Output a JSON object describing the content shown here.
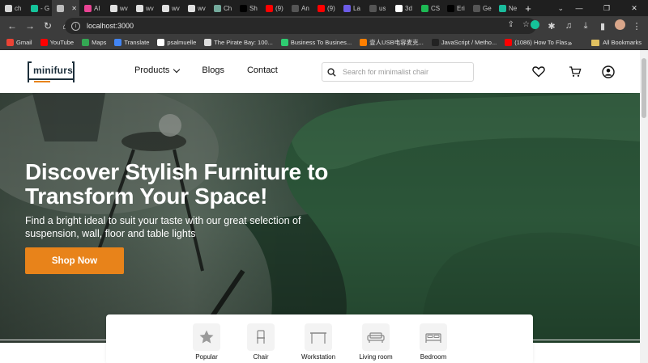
{
  "browser": {
    "tabs": [
      {
        "title": "ch",
        "color": "#d6d6d6"
      },
      {
        "title": "- G",
        "color": "#15c39a"
      },
      {
        "title": "",
        "color": "#bdbdbd",
        "active": true
      },
      {
        "title": "AI",
        "color": "#e84393"
      },
      {
        "title": "wv",
        "color": "#e0e0e0"
      },
      {
        "title": "wv",
        "color": "#e0e0e0"
      },
      {
        "title": "wv",
        "color": "#e0e0e0"
      },
      {
        "title": "wv",
        "color": "#e0e0e0"
      },
      {
        "title": "Ch",
        "color": "#74aa9c"
      },
      {
        "title": "Sh",
        "color": "#000000"
      },
      {
        "title": "(9)",
        "color": "#ff0000"
      },
      {
        "title": "An",
        "color": "#555555"
      },
      {
        "title": "(9)",
        "color": "#ff0000"
      },
      {
        "title": "La",
        "color": "#6c5ce7"
      },
      {
        "title": "us",
        "color": "#555555"
      },
      {
        "title": "3d",
        "color": "#ffffff"
      },
      {
        "title": "CS",
        "color": "#1db954"
      },
      {
        "title": "Eri",
        "color": "#000000"
      },
      {
        "title": "Ge",
        "color": "#555555"
      },
      {
        "title": "Ne",
        "color": "#1abc9c"
      }
    ],
    "url": "localhost:3000",
    "bookmarks": [
      {
        "label": "Gmail",
        "color": "#ea4335"
      },
      {
        "label": "YouTube",
        "color": "#ff0000"
      },
      {
        "label": "Maps",
        "color": "#34a853"
      },
      {
        "label": "Translate",
        "color": "#4285f4"
      },
      {
        "label": "psalmuelle",
        "color": "#ffffff"
      },
      {
        "label": "The Pirate Bay: 100...",
        "color": "#dddddd"
      },
      {
        "label": "Business To Busines...",
        "color": "#2ecc71"
      },
      {
        "label": "壹人USB电容麦克...",
        "color": "#ff7f00"
      },
      {
        "label": "JavaScript / Metho...",
        "color": "#222222"
      },
      {
        "label": "(1086) How To Flas...",
        "color": "#ff0000"
      }
    ],
    "all_bookmarks": "All Bookmarks"
  },
  "site": {
    "logo_text": "minifurs",
    "nav": {
      "products": "Products",
      "blogs": "Blogs",
      "contact": "Contact"
    },
    "search_placeholder": "Search for minimalist chair"
  },
  "hero": {
    "title": "Discover Stylish Furniture to Transform Your Space!",
    "subtitle": "Find a bright ideal to suit your taste with our great selection of suspension, wall, floor and table lights",
    "cta": "Shop Now"
  },
  "categories": [
    {
      "label": "Popular",
      "icon": "star-icon"
    },
    {
      "label": "Chair",
      "icon": "chair-icon"
    },
    {
      "label": "Workstation",
      "icon": "desk-icon"
    },
    {
      "label": "Living room",
      "icon": "sofa-icon"
    },
    {
      "label": "Bedroom",
      "icon": "bed-icon"
    }
  ]
}
